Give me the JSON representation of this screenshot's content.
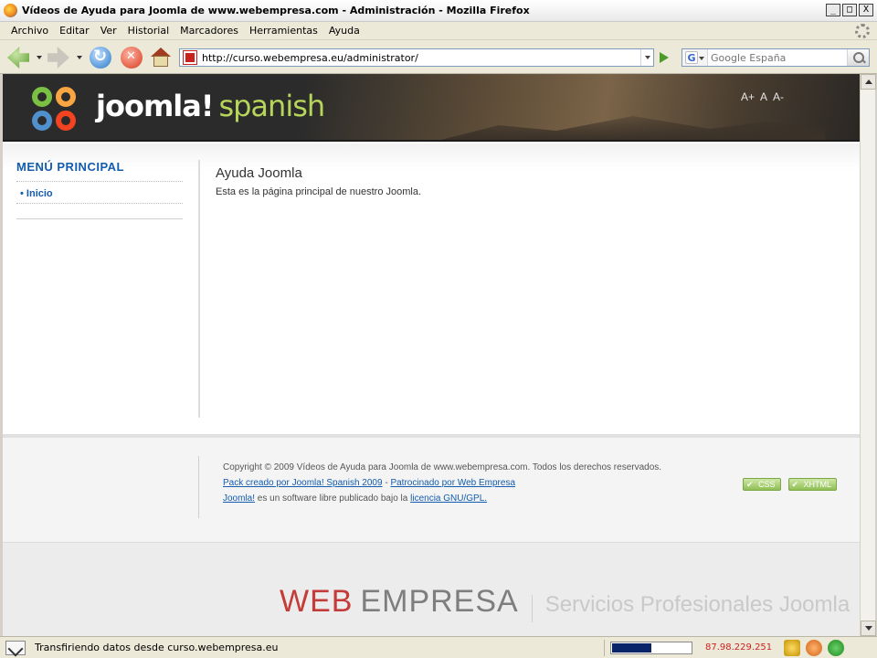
{
  "window": {
    "title": "Vídeos de Ayuda para Joomla de www.webempresa.com - Administración - Mozilla Firefox",
    "controls": [
      "_",
      "□",
      "X"
    ]
  },
  "menubar": {
    "items": [
      "Archivo",
      "Editar",
      "Ver",
      "Historial",
      "Marcadores",
      "Herramientas",
      "Ayuda"
    ]
  },
  "navbar": {
    "url": "http://curso.webempresa.eu/administrator/",
    "search_placeholder": "Google España",
    "search_engine": "G"
  },
  "site": {
    "brand_main": "joomla!",
    "brand_sub": "spanish",
    "font_controls": [
      "A+",
      "A",
      "A-"
    ]
  },
  "sidebar": {
    "heading": "MENÚ PRINCIPAL",
    "items": [
      "Inicio"
    ]
  },
  "content": {
    "title": "Ayuda Joomla",
    "text": "Esta es la página principal de nuestro Joomla."
  },
  "footer": {
    "copyright": "Copyright © 2009 Vídeos de Ayuda para Joomla de www.webempresa.com. Todos los derechos reservados.",
    "pack_link": "Pack creado por Joomla! Spanish 2009",
    "sep": " - ",
    "sponsor_link": "Patrocinado por Web Empresa",
    "joomla_link": "Joomla!",
    "license_text": " es un software libre publicado bajo la ",
    "license_link": "licencia GNU/GPL.",
    "badges": [
      "CSS",
      "XHTML"
    ]
  },
  "watermark": {
    "web": "WEB",
    "empresa": "EMPRESA",
    "services": "Servicios Profesionales Joomla"
  },
  "statusbar": {
    "text": "Transfiriendo datos desde curso.webempresa.eu",
    "progress": 0.5,
    "ip": "87.98.229.251"
  },
  "colors": {
    "link": "#135cae",
    "brand_green": "#b7d55a",
    "watermark_red": "#c43c3a"
  }
}
